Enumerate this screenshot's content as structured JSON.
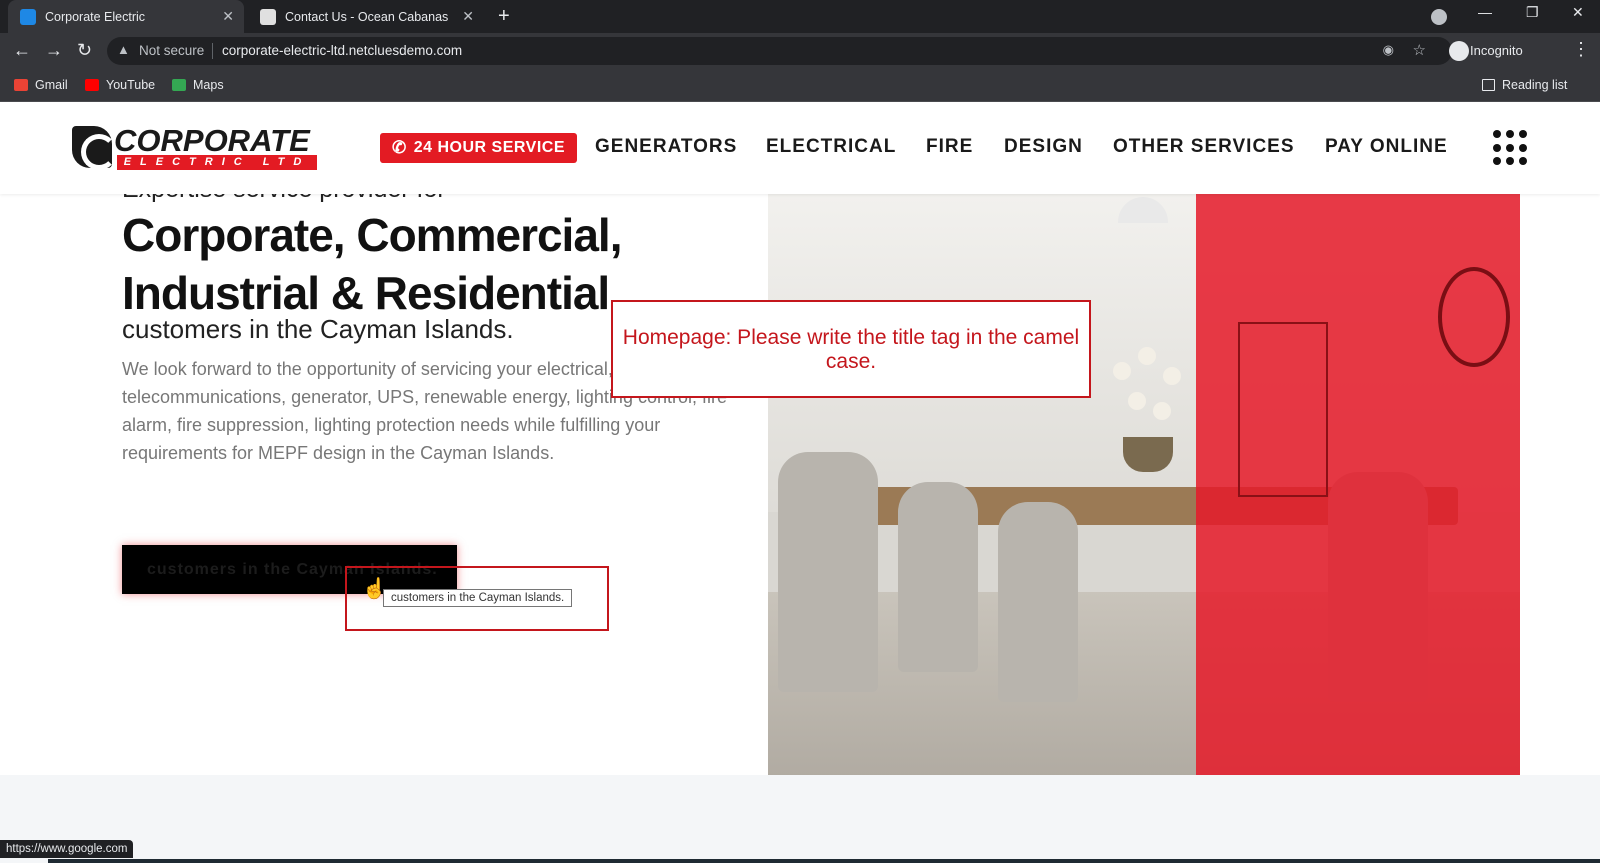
{
  "browser": {
    "tabs": [
      {
        "title": "Corporate Electric",
        "active": true,
        "favicon_color": "#1e88e5"
      },
      {
        "title": "Contact Us - Ocean Cabanas",
        "active": false,
        "favicon_color": "#e0e0e0"
      }
    ],
    "new_tab_icon": "plus-icon",
    "window_controls": [
      "minimize",
      "restore",
      "close"
    ],
    "security_label": "Not secure",
    "url": "corporate-electric-ltd.netcluesdemo.com",
    "profile_label": "Incognito",
    "reading_list_label": "Reading list",
    "bookmarks": [
      {
        "label": "Gmail",
        "icon_color": "#ea4335"
      },
      {
        "label": "YouTube",
        "icon_color": "#ff0000"
      },
      {
        "label": "Maps",
        "icon_color": "#34a853"
      }
    ]
  },
  "site": {
    "logo": {
      "word": "CORPORATE",
      "sub": "ELECTRIC LTD"
    },
    "service_button": "24 HOUR SERVICE",
    "nav": [
      "GENERATORS",
      "ELECTRICAL",
      "FIRE",
      "DESIGN",
      "OTHER SERVICES",
      "PAY ONLINE"
    ],
    "brand_red": "#e31b23"
  },
  "hero": {
    "pre_title": "Expertise service provider for",
    "title": "Corporate, Commercial, Industrial & Residential",
    "subtitle": "customers in the Cayman Islands.",
    "paragraph": "We look forward to the opportunity of servicing your electrical, telecommunications, generator, UPS, renewable energy, lighting control, fire alarm, fire suppression, lighting protection needs while fulfilling your requirements for MEPF design in the Cayman Islands.",
    "cta_label": "customers in the Cayman Islands."
  },
  "annotation": {
    "text": "Homepage: Please write the title tag in the camel case.",
    "tooltip": "customers in the Cayman Islands."
  },
  "status_bar": "https://www.google.com"
}
